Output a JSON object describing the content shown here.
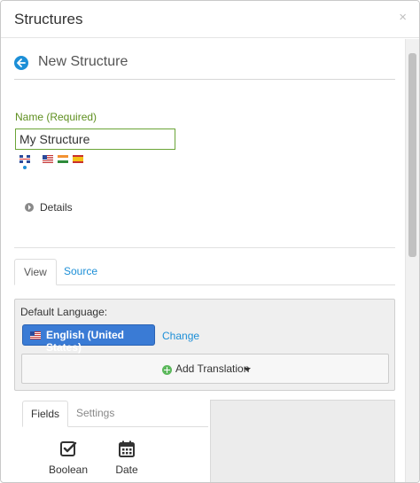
{
  "window": {
    "title": "Structures",
    "close_glyph": "×"
  },
  "header": {
    "page_title": "New Structure",
    "back_icon": "arrow-left-circle-icon"
  },
  "name_field": {
    "label": "Name (Required)",
    "value": "My Structure"
  },
  "flags": [
    "flag-uk-icon",
    "flag-us-icon",
    "flag-india-icon",
    "flag-spain-icon"
  ],
  "details": {
    "label": "Details"
  },
  "tabs": [
    {
      "label": "View",
      "active": true
    },
    {
      "label": "Source",
      "active": false
    }
  ],
  "language_panel": {
    "default_label": "Default Language:",
    "selected_language": "English (United States)",
    "change_label": "Change",
    "add_translation_label": "Add Translation"
  },
  "palette": {
    "tabs": [
      {
        "label": "Fields",
        "active": true
      },
      {
        "label": "Settings",
        "active": false
      }
    ],
    "fields": [
      {
        "label": "Boolean",
        "icon": "checkbox-icon"
      },
      {
        "label": "Date",
        "icon": "calendar-icon"
      }
    ]
  },
  "colors": {
    "accent": "#1d8fd7",
    "required_label": "#5e8f1f",
    "input_border": "#6ba437",
    "language_pill": "#3a7bd5"
  }
}
